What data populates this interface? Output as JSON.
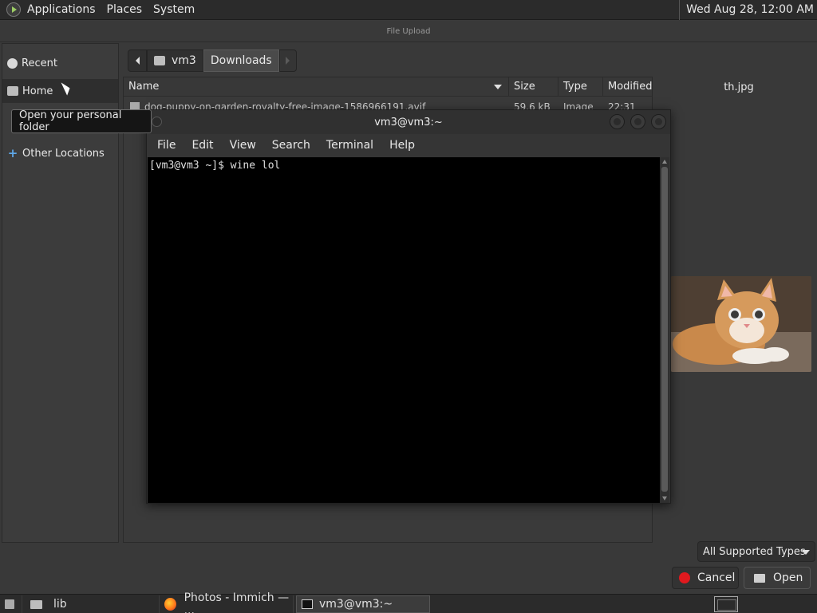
{
  "top_panel": {
    "menu": [
      "Applications",
      "Places",
      "System"
    ],
    "clock": "Wed Aug 28, 12:00 AM"
  },
  "file_dialog": {
    "title": "File Upload",
    "sidebar": [
      "Recent",
      "Home",
      "Other Locations"
    ],
    "pathbar": [
      "vm3",
      "Downloads"
    ],
    "columns": [
      "Name",
      "Size",
      "Type",
      "Modified"
    ],
    "files": [
      {
        "name": "dog-puppy-on-garden-royalty-free-image-1586966191.avif",
        "size": "59.6 kB",
        "type": "Image",
        "modified": "22:31"
      }
    ],
    "preview_filename": "th.jpg",
    "filter": "All Supported Types",
    "cancel_label": "Cancel",
    "open_label": "Open"
  },
  "tooltip": "Open your personal folder",
  "terminal": {
    "title": "vm3@vm3:~",
    "menu": [
      "File",
      "Edit",
      "View",
      "Search",
      "Terminal",
      "Help"
    ],
    "content": "[vm3@vm3 ~]$ wine lol"
  },
  "taskbar": {
    "items": [
      "lib",
      "Photos - Immich — ...",
      "vm3@vm3:~"
    ]
  }
}
